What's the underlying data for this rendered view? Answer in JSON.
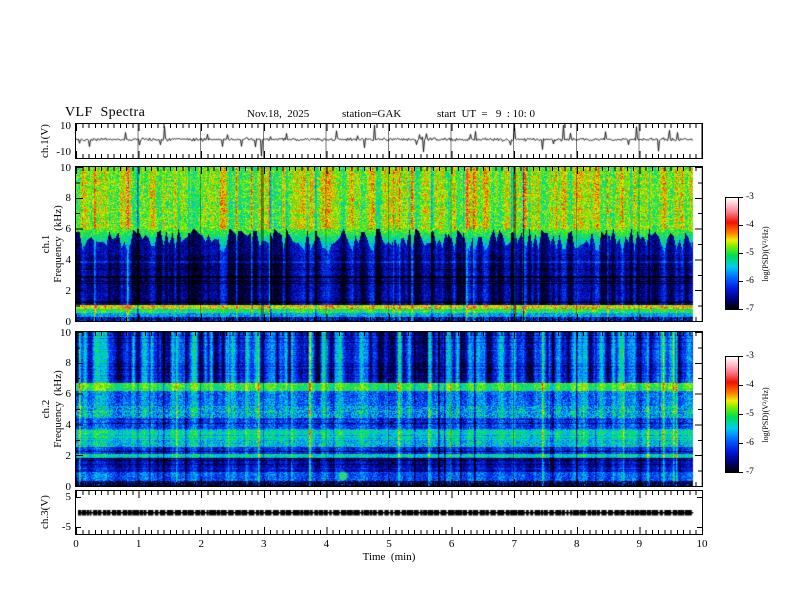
{
  "header": {
    "title": "VLF  Spectra",
    "date": "Nov.18,  2025",
    "station": "station=GAK",
    "start_ut": "start  UT  =   9  : 10: 0"
  },
  "x_axis": {
    "label": "Time  (min)",
    "ticks": [
      "0",
      "1",
      "2",
      "3",
      "4",
      "5",
      "6",
      "7",
      "8",
      "9",
      "10"
    ]
  },
  "panels": {
    "ch1_wave": {
      "ylabel": "ch.1(V)",
      "ytick_top": "10",
      "ytick_bottom": "-10"
    },
    "ch1_spec": {
      "ylabel_line1": "ch.1",
      "ylabel_line2": "Frequency  (kHz)",
      "yticks": [
        "10",
        "8",
        "6",
        "4",
        "2",
        "0"
      ]
    },
    "ch2_spec": {
      "ylabel_line1": "ch.2",
      "ylabel_line2": "Frequency  (kHz)",
      "yticks": [
        "10",
        "8",
        "6",
        "4",
        "2",
        "0"
      ]
    },
    "ch3_wave": {
      "ylabel": "ch.3(V)",
      "ytick_top": "5",
      "ytick_bottom": "-5"
    }
  },
  "colorbars": [
    {
      "label": "log(PSD)(V²/Hz)",
      "ticks": [
        "-3",
        "-4",
        "-5",
        "-6",
        "-7"
      ]
    },
    {
      "label": "log(PSD)(V²/Hz)",
      "ticks": [
        "-3",
        "-4",
        "-5",
        "-6",
        "-7"
      ]
    }
  ],
  "chart_data": [
    {
      "type": "line",
      "name": "ch.1 voltage waveform",
      "xlim": [
        0,
        10
      ],
      "x_data_end": 9.86,
      "x_unit": "min",
      "ylim": [
        -10,
        10
      ],
      "y_unit": "V",
      "baseline": 0.9,
      "noise_amp": 1.2,
      "spikes_fixed": [
        {
          "t": 0.78,
          "v": 5
        },
        {
          "t": 2.1,
          "v": 4
        },
        {
          "t": 2.95,
          "v": -9
        },
        {
          "t": 3.35,
          "v": 4.5
        },
        {
          "t": 4.15,
          "v": 6
        },
        {
          "t": 4.6,
          "v": -4
        },
        {
          "t": 5.55,
          "v": -6.5
        },
        {
          "t": 6.3,
          "v": 4
        },
        {
          "t": 7.0,
          "v": 8
        },
        {
          "t": 7.45,
          "v": -5
        },
        {
          "t": 7.78,
          "v": 9.5
        },
        {
          "t": 8.45,
          "v": 5.5
        },
        {
          "t": 8.95,
          "v": 8.5
        },
        {
          "t": 9.3,
          "v": -6
        },
        {
          "t": 9.6,
          "v": 5
        }
      ],
      "random_spikes": {
        "count": 25,
        "amp_range": [
          2,
          5.5
        ]
      },
      "color": "#000000"
    },
    {
      "type": "heatmap",
      "name": "ch.1 VLF spectrogram",
      "xlim": [
        0,
        10
      ],
      "x_data_end": 9.86,
      "ylim": [
        0,
        10
      ],
      "value_range": [
        -7,
        -3
      ],
      "value_label": "log(PSD)(V²/Hz)",
      "colormap": [
        [
          0.0,
          "#000000"
        ],
        [
          0.08,
          "#000070"
        ],
        [
          0.18,
          "#0018dd"
        ],
        [
          0.28,
          "#0066ff"
        ],
        [
          0.38,
          "#00ccee"
        ],
        [
          0.48,
          "#00dd55"
        ],
        [
          0.56,
          "#77ee00"
        ],
        [
          0.62,
          "#eeee00"
        ],
        [
          0.69,
          "#ff7700"
        ],
        [
          0.78,
          "#ee1100"
        ],
        [
          0.88,
          "#ff8899"
        ],
        [
          1.0,
          "#ffffff"
        ]
      ],
      "bands": [
        {
          "f_lo": 6.0,
          "f_hi": 10.0,
          "mean": -4.7,
          "stripe": 0.45,
          "noise": 0.45,
          "row": 0.25
        },
        {
          "f_lo": 4.3,
          "f_hi": 6.0,
          "mean": -6.45,
          "stripe": 0.4,
          "noise": 0.3,
          "row": 0.5,
          "grass": true
        },
        {
          "f_lo": 1.05,
          "f_hi": 4.3,
          "mean": -6.55,
          "stripe": 0.5,
          "noise": 0.3,
          "row": 1.0
        },
        {
          "f_lo": 0.75,
          "f_hi": 1.05,
          "mean": -4.45,
          "stripe": 0.2,
          "noise": 0.4,
          "row": 0.4
        },
        {
          "f_lo": 0.5,
          "f_hi": 0.75,
          "mean": -5.05,
          "stripe": 0.15,
          "noise": 0.35,
          "row": 0.4
        },
        {
          "f_lo": 0.28,
          "f_hi": 0.5,
          "mean": -5.6,
          "stripe": 0.2,
          "noise": 0.35,
          "row": 0.4
        },
        {
          "f_lo": 0.0,
          "f_hi": 0.28,
          "mean": -6.35,
          "stripe": 0.3,
          "noise": 0.5,
          "row": 0.5
        }
      ],
      "features": {
        "dark_columns_min": [
          2.95,
          7.0
        ],
        "minute_gridlines": true
      }
    },
    {
      "type": "heatmap",
      "name": "ch.2 VLF spectrogram",
      "xlim": [
        0,
        10
      ],
      "x_data_end": 9.86,
      "ylim": [
        0,
        10
      ],
      "value_range": [
        -7,
        -3
      ],
      "value_label": "log(PSD)(V²/Hz)",
      "colormap": [
        [
          0.0,
          "#000000"
        ],
        [
          0.08,
          "#000070"
        ],
        [
          0.18,
          "#0018dd"
        ],
        [
          0.28,
          "#0066ff"
        ],
        [
          0.38,
          "#00ccee"
        ],
        [
          0.48,
          "#00dd55"
        ],
        [
          0.56,
          "#77ee00"
        ],
        [
          0.62,
          "#eeee00"
        ],
        [
          0.69,
          "#ff7700"
        ],
        [
          0.78,
          "#ee1100"
        ],
        [
          0.88,
          "#ff8899"
        ],
        [
          1.0,
          "#ffffff"
        ]
      ],
      "bands": [
        {
          "f_lo": 6.7,
          "f_hi": 10.0,
          "mean": -6.0,
          "stripe": 0.9,
          "noise": 0.3,
          "row": 0.5
        },
        {
          "f_lo": 6.15,
          "f_hi": 6.7,
          "mean": -4.95,
          "stripe": 0.3,
          "noise": 0.3,
          "row": 0.5
        },
        {
          "f_lo": 5.2,
          "f_hi": 6.15,
          "mean": -5.8,
          "stripe": 0.4,
          "noise": 0.4,
          "row": 1.0
        },
        {
          "f_lo": 4.4,
          "f_hi": 5.2,
          "mean": -5.55,
          "stripe": 0.35,
          "noise": 0.55,
          "row": 1.0
        },
        {
          "f_lo": 3.7,
          "f_hi": 4.4,
          "mean": -6.0,
          "stripe": 0.35,
          "noise": 0.4,
          "row": 1.0
        },
        {
          "f_lo": 2.9,
          "f_hi": 3.7,
          "mean": -5.25,
          "stripe": 0.25,
          "noise": 0.35,
          "row": 0.7
        },
        {
          "f_lo": 2.55,
          "f_hi": 2.9,
          "mean": -5.45,
          "stripe": 0.25,
          "noise": 0.45,
          "row": 0.7
        },
        {
          "f_lo": 2.1,
          "f_hi": 2.55,
          "mean": -6.15,
          "stripe": 0.3,
          "noise": 0.35,
          "row": 1.0
        },
        {
          "f_lo": 1.8,
          "f_hi": 2.1,
          "mean": -5.3,
          "stripe": 0.2,
          "noise": 0.35,
          "row": 0.6
        },
        {
          "f_lo": 0.9,
          "f_hi": 1.8,
          "mean": -6.4,
          "stripe": 0.3,
          "noise": 0.3,
          "row": 1.0
        },
        {
          "f_lo": 0.35,
          "f_hi": 0.9,
          "mean": -5.95,
          "stripe": 0.3,
          "noise": 0.35,
          "row": 0.8
        },
        {
          "f_lo": 0.0,
          "f_hi": 0.35,
          "mean": -6.75,
          "stripe": 0.2,
          "noise": 0.8,
          "row": 0.5
        }
      ],
      "features": {
        "green_blob": {
          "t": 4.27,
          "f": 0.65
        },
        "minute_gridlines": true
      }
    },
    {
      "type": "line",
      "name": "ch.3 voltage (flat)",
      "xlim": [
        0,
        10
      ],
      "x_data_end": 9.86,
      "x_unit": "min",
      "ylim": [
        -5,
        5
      ],
      "y_unit": "V",
      "value": 0,
      "style": "thick-dashed",
      "color": "#000000"
    }
  ]
}
